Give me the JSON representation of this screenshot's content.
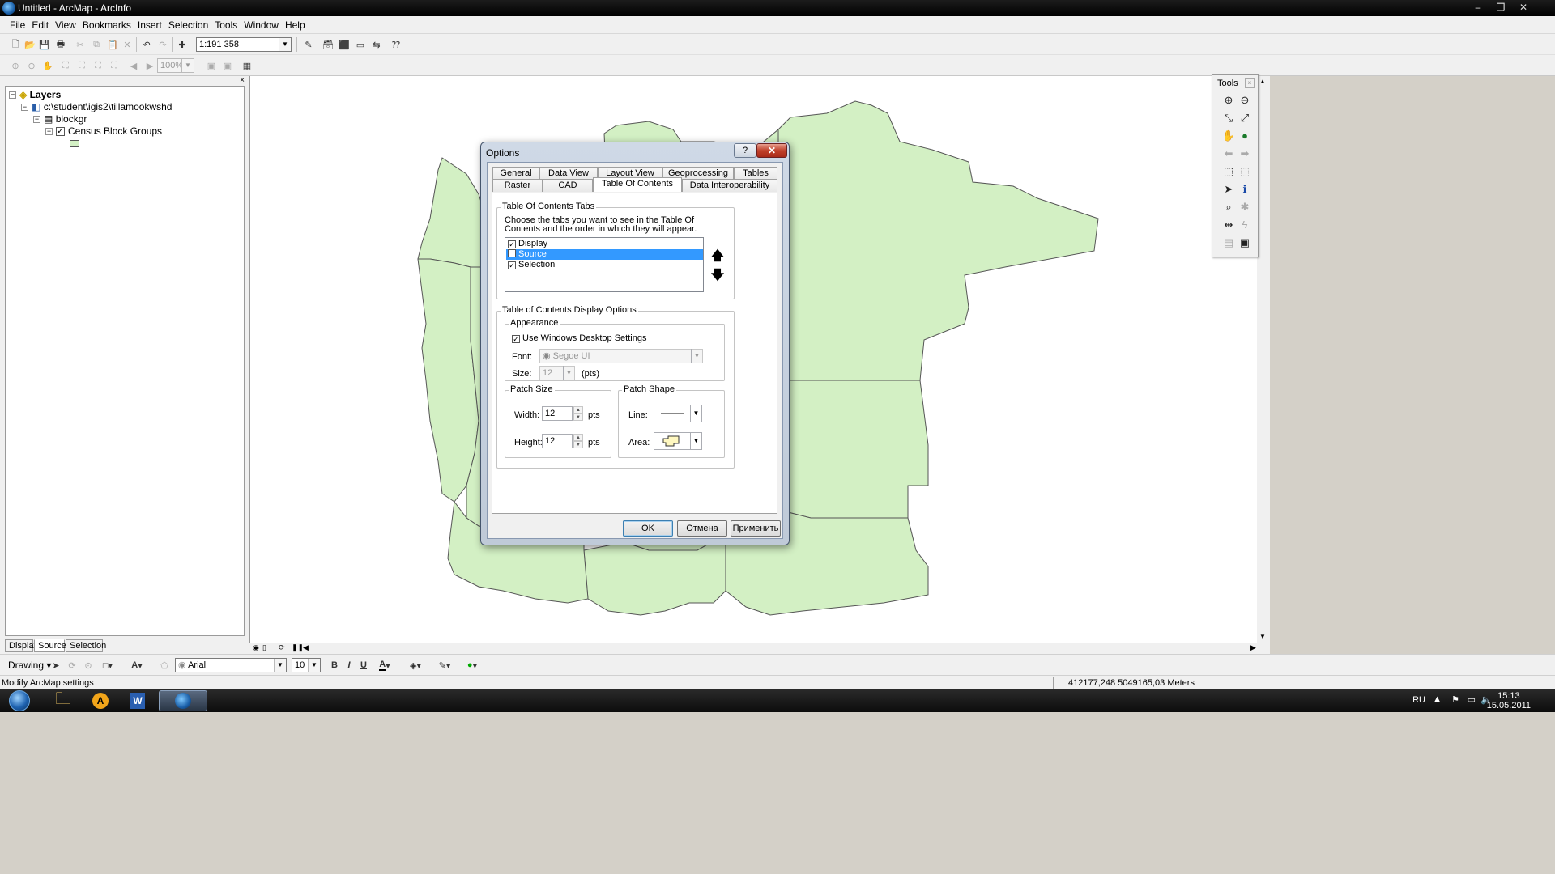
{
  "window": {
    "title": "Untitled - ArcMap - ArcInfo",
    "controls": [
      "–",
      "❐",
      "✕"
    ]
  },
  "menu": [
    "File",
    "Edit",
    "View",
    "Bookmarks",
    "Insert",
    "Selection",
    "Tools",
    "Window",
    "Help"
  ],
  "toolbar": {
    "scale": "1:191 358",
    "zoom": "100%"
  },
  "toc": {
    "close": "×",
    "tree": {
      "root": "Layers",
      "path": "c:\\student\\igis2\\tillamookwshd",
      "dataset": "blockgr",
      "layer": "Census Block Groups",
      "layer_checked": true
    },
    "tabs": [
      "Display",
      "Source",
      "Selection"
    ],
    "selected_tab": "Source"
  },
  "map": {
    "fill_color": "#d3f0c4",
    "stroke_color": "#555555"
  },
  "tools_palette": {
    "title": "Tools",
    "close": "×"
  },
  "dialog": {
    "title": "Options",
    "help": "?",
    "close": "✕",
    "tabs_row1": [
      "General",
      "Data View",
      "Layout View",
      "Geoprocessing",
      "Tables"
    ],
    "tabs_row2": [
      "Raster",
      "CAD",
      "Table Of Contents",
      "Data Interoperability"
    ],
    "selected_tab": "Table Of Contents",
    "toc_tabs_group": {
      "label": "Table Of Contents Tabs",
      "description": "Choose the tabs you want to see in the Table Of Contents and the order in which they will appear.",
      "items": [
        {
          "label": "Display",
          "checked": true,
          "selected": false
        },
        {
          "label": "Source",
          "checked": false,
          "selected": true
        },
        {
          "label": "Selection",
          "checked": true,
          "selected": false
        }
      ],
      "up": "🡅",
      "down": "🡇"
    },
    "display_options": {
      "label": "Table of Contents Display Options",
      "appearance": {
        "label": "Appearance",
        "use_windows_settings": "Use Windows Desktop Settings",
        "use_windows_checked": true,
        "font_label": "Font:",
        "font_value": "Segoe UI",
        "size_label": "Size:",
        "size_value": "12",
        "size_unit": "(pts)"
      },
      "patch_size": {
        "label": "Patch Size",
        "width_label": "Width:",
        "width_value": "12",
        "height_label": "Height:",
        "height_value": "12",
        "unit": "pts"
      },
      "patch_shape": {
        "label": "Patch Shape",
        "line_label": "Line:",
        "area_label": "Area:"
      }
    },
    "buttons": {
      "ok": "OK",
      "cancel": "Отмена",
      "apply": "Применить"
    }
  },
  "drawing_toolbar": {
    "drawing": "Drawing",
    "font": "Arial",
    "size": "10",
    "bold": "B",
    "italic": "I",
    "underline": "U"
  },
  "status": {
    "message": "Modify ArcMap settings",
    "coords": "412177,248  5049165,03 Meters"
  },
  "taskbar": {
    "language": "RU",
    "time": "15:13",
    "date": "15.05.2011"
  }
}
